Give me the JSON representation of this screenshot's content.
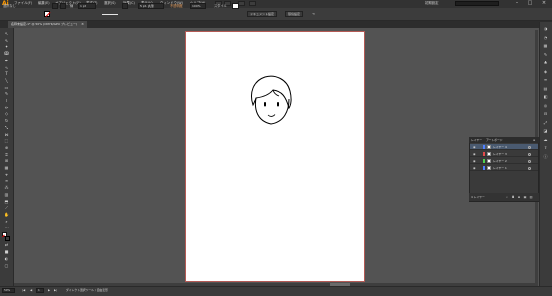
{
  "app": {
    "logo": "Ai"
  },
  "menubar": {
    "items": [
      "ファイル(F)",
      "編集(E)",
      "オブジェクト(O)",
      "書式(T)",
      "選択(S)",
      "効果(C)",
      "表示(V)",
      "ウィンドウ(W)",
      "ヘルプ(H)"
    ],
    "workspace_label": "初期設定"
  },
  "controlbar": {
    "selection_label": "選択なし",
    "stroke_label": "線",
    "stroke_value": "1 pt",
    "brush_label": "5 pt. 丸筆",
    "opacity_label": "不透明度",
    "opacity_value": "100%",
    "style_label": "スタイル",
    "doc_setup_button": "ドキュメント設定",
    "prefs_button": "環境設定"
  },
  "document": {
    "tab_title": "名称未設定-1* @ 50% (CMYK/GPU プレビュー)",
    "close_glyph": "×"
  },
  "layers_panel": {
    "tabs": [
      "レイヤー",
      "アートボード"
    ],
    "layers": [
      {
        "name": "レイヤー 4",
        "color": "#4f7fff",
        "selected": true
      },
      {
        "name": "レイヤー 3",
        "color": "#e24a4a",
        "selected": false
      },
      {
        "name": "レイヤー 2",
        "color": "#4fd24f",
        "selected": false
      },
      {
        "name": "レイヤー 1",
        "color": "#4f7fff",
        "selected": false
      }
    ],
    "footer_count": "4 レイヤー"
  },
  "statusbar": {
    "zoom": "50%",
    "page": "1",
    "tool_hint": "ダイレクト選択ツール / 自由変形"
  },
  "colors": {
    "artboard_border": "#b45a55",
    "accent_logo": "#ff9a00",
    "selection_row": "#4a5a70"
  }
}
